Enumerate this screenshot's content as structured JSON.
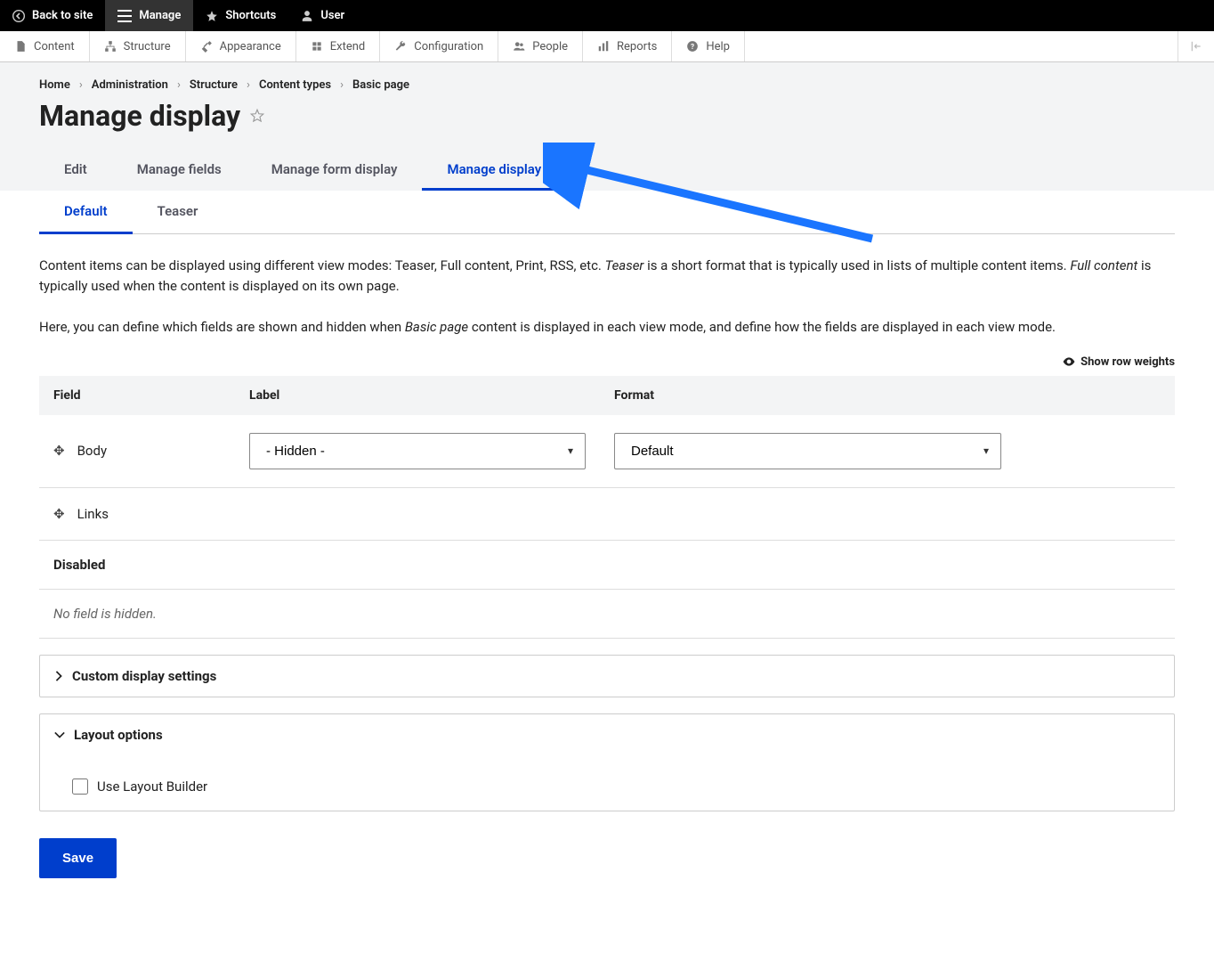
{
  "topbar": {
    "back_to_site": "Back to site",
    "manage": "Manage",
    "shortcuts": "Shortcuts",
    "user": "User"
  },
  "adminbar": {
    "content": "Content",
    "structure": "Structure",
    "appearance": "Appearance",
    "extend": "Extend",
    "configuration": "Configuration",
    "people": "People",
    "reports": "Reports",
    "help": "Help"
  },
  "breadcrumb": {
    "home": "Home",
    "administration": "Administration",
    "structure": "Structure",
    "content_types": "Content types",
    "basic_page": "Basic page"
  },
  "page_title": "Manage display",
  "primary_tabs": {
    "edit": "Edit",
    "manage_fields": "Manage fields",
    "manage_form_display": "Manage form display",
    "manage_display": "Manage display"
  },
  "secondary_tabs": {
    "default": "Default",
    "teaser": "Teaser"
  },
  "desc1_a": "Content items can be displayed using different view modes: Teaser, Full content, Print, RSS, etc. ",
  "desc1_teaser": "Teaser",
  "desc1_b": " is a short format that is typically used in lists of multiple content items. ",
  "desc1_full": "Full content",
  "desc1_c": " is typically used when the content is displayed on its own page.",
  "desc2_a": "Here, you can define which fields are shown and hidden when ",
  "desc2_basic": "Basic page",
  "desc2_b": " content is displayed in each view mode, and define how the fields are displayed in each view mode.",
  "show_row_weights": "Show row weights",
  "thead": {
    "field": "Field",
    "label": "Label",
    "format": "Format"
  },
  "rows": {
    "body": {
      "name": "Body",
      "label_select": "- Hidden -",
      "format_select": "Default"
    },
    "links": {
      "name": "Links"
    }
  },
  "disabled_heading": "Disabled",
  "no_hidden": "No field is hidden.",
  "custom_settings": "Custom display settings",
  "layout_options": "Layout options",
  "use_layout_builder": "Use Layout Builder",
  "save": "Save"
}
